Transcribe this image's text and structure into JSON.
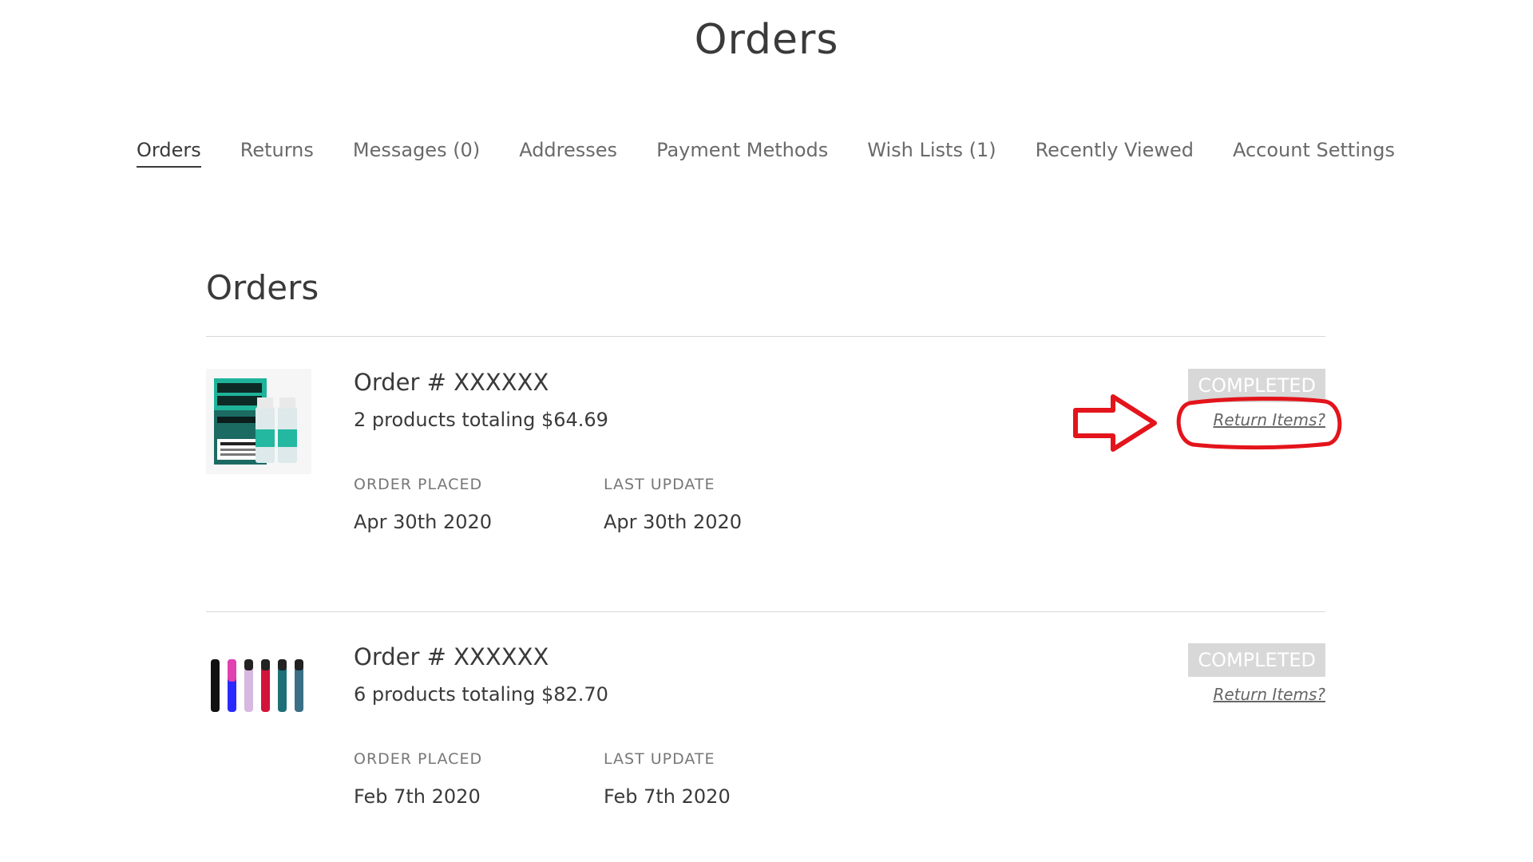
{
  "page": {
    "title": "Orders"
  },
  "nav": {
    "items": [
      {
        "label": "Orders",
        "active": true
      },
      {
        "label": "Returns"
      },
      {
        "label": "Messages (0)"
      },
      {
        "label": "Addresses"
      },
      {
        "label": "Payment Methods"
      },
      {
        "label": "Wish Lists (1)"
      },
      {
        "label": "Recently Viewed"
      },
      {
        "label": "Account Settings"
      }
    ]
  },
  "orders_section": {
    "title": "Orders",
    "orders": [
      {
        "number": "Order # XXXXXX",
        "summary": "2 products totaling $64.69",
        "placed_label": "ORDER PLACED",
        "placed_value": "Apr 30th 2020",
        "updated_label": "LAST UPDATE",
        "updated_value": "Apr 30th 2020",
        "status": "COMPLETED",
        "return_label": "Return Items?"
      },
      {
        "number": "Order # XXXXXX",
        "summary": "6 products totaling $82.70",
        "placed_label": "ORDER PLACED",
        "placed_value": "Feb 7th 2020",
        "updated_label": "LAST UPDATE",
        "updated_value": "Feb 7th 2020",
        "status": "COMPLETED",
        "return_label": "Return Items?"
      }
    ]
  },
  "colors": {
    "annotation": "#e3141b",
    "status_badge_bg": "#d8d8d8",
    "text": "#3a3a3a"
  }
}
